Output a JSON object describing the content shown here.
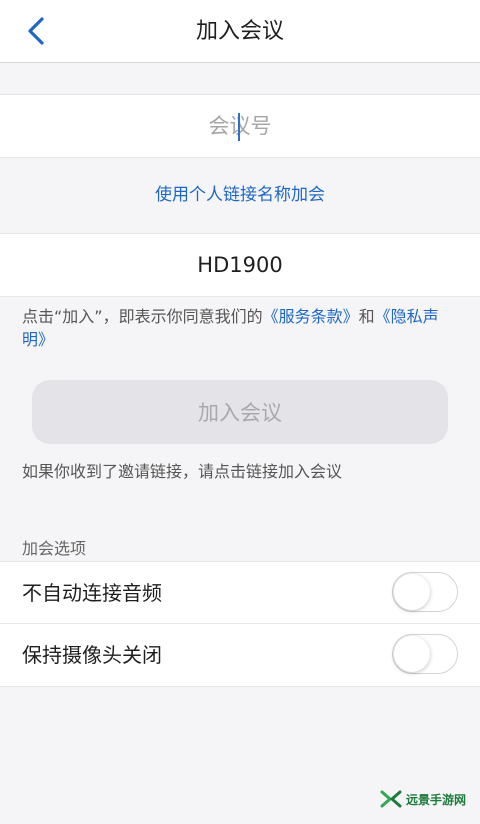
{
  "header": {
    "title": "加入会议",
    "back_icon": "chevron-left-icon"
  },
  "meeting_input": {
    "placeholder": "会议号",
    "value": ""
  },
  "personal_link_label": "使用个人链接名称加会",
  "name_input": {
    "value": "HD1900"
  },
  "terms": {
    "prefix": "点击“加入”，即表示你同意我们的",
    "service_link": "《服务条款》",
    "conjunction": "和",
    "privacy_link": "《隐私声明》"
  },
  "join_button_label": "加入会议",
  "invite_hint": "如果你收到了邀请链接，请点击链接加入会议",
  "options": {
    "section_label": "加会选项",
    "items": [
      {
        "label": "不自动连接音频",
        "enabled": false
      },
      {
        "label": "保持摄像头关闭",
        "enabled": false
      }
    ]
  },
  "watermark": {
    "text": "远景手游网",
    "logo_icon": "brand-logo-icon"
  },
  "colors": {
    "accent": "#1f67c4",
    "background": "#f5f5f7",
    "button_disabled": "#e4e4e8",
    "watermark_green": "#1e7a3c"
  }
}
